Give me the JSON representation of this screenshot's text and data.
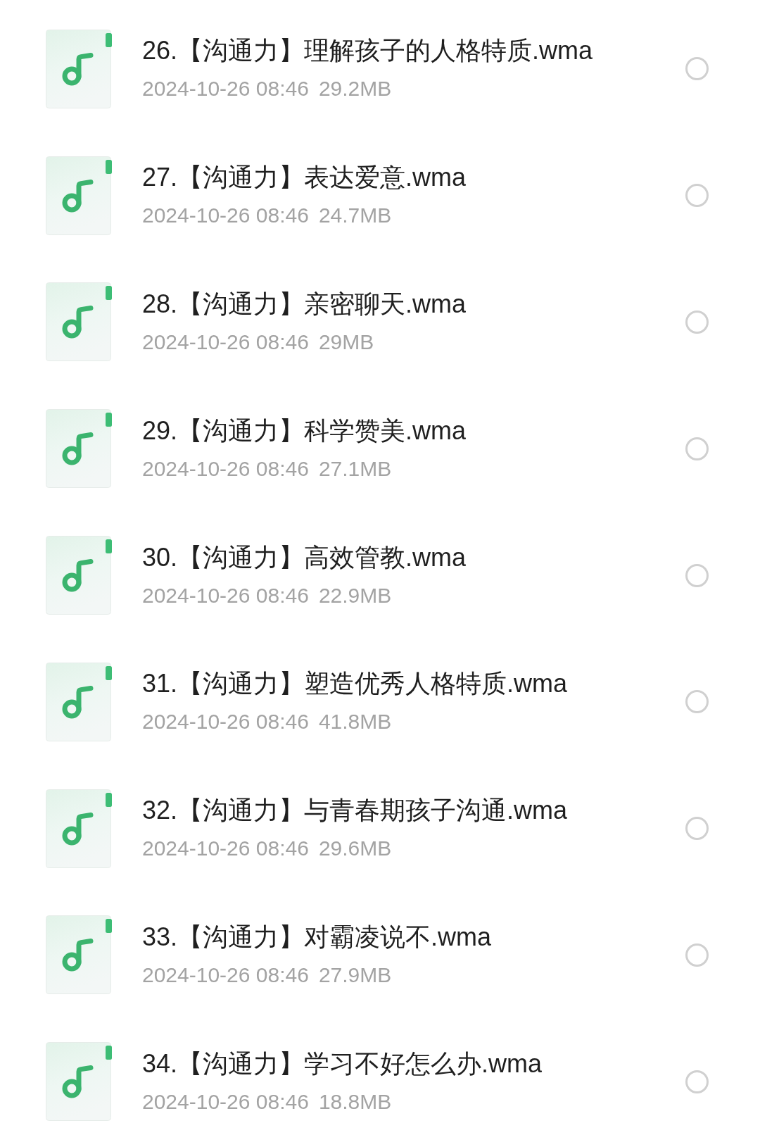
{
  "files": [
    {
      "name": "26.【沟通力】理解孩子的人格特质.wma",
      "modified": "2024-10-26 08:46",
      "size": "29.2MB",
      "selected": false
    },
    {
      "name": "27.【沟通力】表达爱意.wma",
      "modified": "2024-10-26 08:46",
      "size": "24.7MB",
      "selected": false
    },
    {
      "name": "28.【沟通力】亲密聊天.wma",
      "modified": "2024-10-26 08:46",
      "size": "29MB",
      "selected": false
    },
    {
      "name": "29.【沟通力】科学赞美.wma",
      "modified": "2024-10-26 08:46",
      "size": "27.1MB",
      "selected": false
    },
    {
      "name": "30.【沟通力】高效管教.wma",
      "modified": "2024-10-26 08:46",
      "size": "22.9MB",
      "selected": false
    },
    {
      "name": "31.【沟通力】塑造优秀人格特质.wma",
      "modified": "2024-10-26 08:46",
      "size": "41.8MB",
      "selected": false
    },
    {
      "name": "32.【沟通力】与青春期孩子沟通.wma",
      "modified": "2024-10-26 08:46",
      "size": "29.6MB",
      "selected": false
    },
    {
      "name": "33.【沟通力】对霸凌说不.wma",
      "modified": "2024-10-26 08:46",
      "size": "27.9MB",
      "selected": false
    },
    {
      "name": "34.【沟通力】学习不好怎么办.wma",
      "modified": "2024-10-26 08:46",
      "size": "18.8MB",
      "selected": false
    }
  ]
}
